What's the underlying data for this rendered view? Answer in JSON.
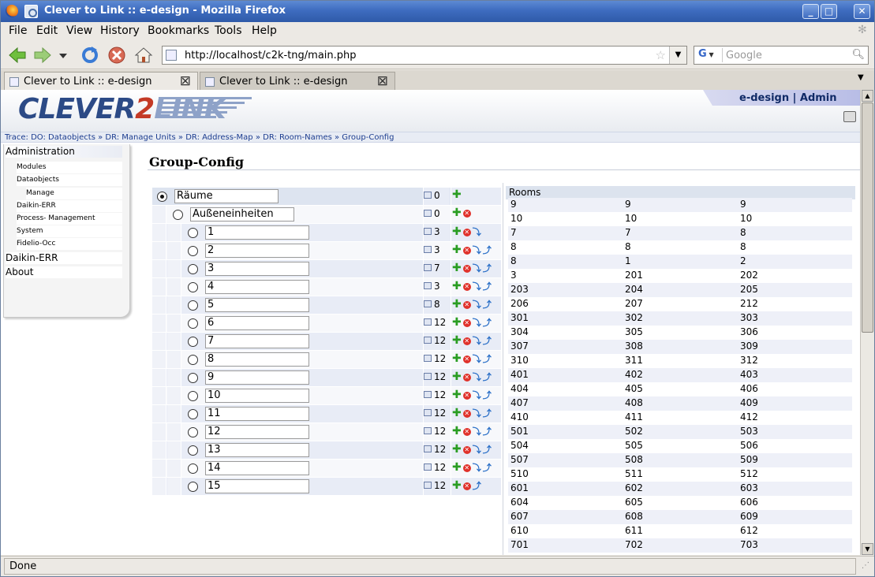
{
  "window": {
    "title": "Clever to Link :: e-design - Mozilla Firefox",
    "buttons": {
      "minimize": "_",
      "maximize": "□",
      "close": "✕"
    }
  },
  "menu": [
    "File",
    "Edit",
    "View",
    "History",
    "Bookmarks",
    "Tools",
    "Help"
  ],
  "menu_accesskeys": [
    "F",
    "E",
    "V",
    "s",
    "B",
    "T",
    "H"
  ],
  "url": "http://localhost/c2k-tng/main.php",
  "search": {
    "engine": "G",
    "placeholder": "Google"
  },
  "tabs": [
    {
      "label": "Clever to Link :: e-design",
      "active": true
    },
    {
      "label": "Clever to Link :: e-design",
      "active": false
    }
  ],
  "header": {
    "logo_part1": "CLEVER",
    "logo_part2": "2",
    "logo_part3": "LINK",
    "user": "e-design | Admin"
  },
  "trace": "Trace: DO: Dataobjects » DR: Manage Units » DR: Address-Map » DR: Room-Names » Group-Config",
  "sidebar": [
    {
      "label": "Administration",
      "level": 0
    },
    {
      "label": "Modules",
      "level": 1
    },
    {
      "label": "Dataobjects",
      "level": 1
    },
    {
      "label": "Manage",
      "level": 2
    },
    {
      "label": "Daikin-ERR",
      "level": 1
    },
    {
      "label": "Process- Management",
      "level": 1
    },
    {
      "label": "System",
      "level": 1
    },
    {
      "label": "Fidelio-Occ",
      "level": 1
    },
    {
      "label": "Daikin-ERR",
      "level": 0
    },
    {
      "label": "About",
      "level": 0
    }
  ],
  "page_title": "Group-Config",
  "tree": [
    {
      "name": "Räume",
      "count": "0",
      "level": 0,
      "selected": true,
      "actions": [
        "add"
      ]
    },
    {
      "name": "Außeneinheiten",
      "count": "0",
      "level": 1,
      "selected": false,
      "actions": [
        "add",
        "del"
      ]
    },
    {
      "name": "1",
      "count": "3",
      "level": 2,
      "selected": false,
      "actions": [
        "add",
        "del",
        "down"
      ]
    },
    {
      "name": "2",
      "count": "3",
      "level": 2,
      "selected": false,
      "actions": [
        "add",
        "del",
        "down",
        "up"
      ]
    },
    {
      "name": "3",
      "count": "7",
      "level": 2,
      "selected": false,
      "actions": [
        "add",
        "del",
        "down",
        "up"
      ]
    },
    {
      "name": "4",
      "count": "3",
      "level": 2,
      "selected": false,
      "actions": [
        "add",
        "del",
        "down",
        "up"
      ]
    },
    {
      "name": "5",
      "count": "8",
      "level": 2,
      "selected": false,
      "actions": [
        "add",
        "del",
        "down",
        "up"
      ]
    },
    {
      "name": "6",
      "count": "12",
      "level": 2,
      "selected": false,
      "actions": [
        "add",
        "del",
        "down",
        "up"
      ]
    },
    {
      "name": "7",
      "count": "12",
      "level": 2,
      "selected": false,
      "actions": [
        "add",
        "del",
        "down",
        "up"
      ]
    },
    {
      "name": "8",
      "count": "12",
      "level": 2,
      "selected": false,
      "actions": [
        "add",
        "del",
        "down",
        "up"
      ]
    },
    {
      "name": "9",
      "count": "12",
      "level": 2,
      "selected": false,
      "actions": [
        "add",
        "del",
        "down",
        "up"
      ]
    },
    {
      "name": "10",
      "count": "12",
      "level": 2,
      "selected": false,
      "actions": [
        "add",
        "del",
        "down",
        "up"
      ]
    },
    {
      "name": "11",
      "count": "12",
      "level": 2,
      "selected": false,
      "actions": [
        "add",
        "del",
        "down",
        "up"
      ]
    },
    {
      "name": "12",
      "count": "12",
      "level": 2,
      "selected": false,
      "actions": [
        "add",
        "del",
        "down",
        "up"
      ]
    },
    {
      "name": "13",
      "count": "12",
      "level": 2,
      "selected": false,
      "actions": [
        "add",
        "del",
        "down",
        "up"
      ]
    },
    {
      "name": "14",
      "count": "12",
      "level": 2,
      "selected": false,
      "actions": [
        "add",
        "del",
        "down",
        "up"
      ]
    },
    {
      "name": "15",
      "count": "12",
      "level": 2,
      "selected": false,
      "actions": [
        "add",
        "del",
        "up"
      ]
    }
  ],
  "rooms": {
    "header": "Rooms",
    "rows": [
      [
        "9",
        "9",
        "9"
      ],
      [
        "10",
        "10",
        "10"
      ],
      [
        "7",
        "7",
        "8"
      ],
      [
        "8",
        "8",
        "8"
      ],
      [
        "8",
        "1",
        "2"
      ],
      [
        "3",
        "201",
        "202"
      ],
      [
        "203",
        "204",
        "205"
      ],
      [
        "206",
        "207",
        "212"
      ],
      [
        "301",
        "302",
        "303"
      ],
      [
        "304",
        "305",
        "306"
      ],
      [
        "307",
        "308",
        "309"
      ],
      [
        "310",
        "311",
        "312"
      ],
      [
        "401",
        "402",
        "403"
      ],
      [
        "404",
        "405",
        "406"
      ],
      [
        "407",
        "408",
        "409"
      ],
      [
        "410",
        "411",
        "412"
      ],
      [
        "501",
        "502",
        "503"
      ],
      [
        "504",
        "505",
        "506"
      ],
      [
        "507",
        "508",
        "509"
      ],
      [
        "510",
        "511",
        "512"
      ],
      [
        "601",
        "602",
        "603"
      ],
      [
        "604",
        "605",
        "606"
      ],
      [
        "607",
        "608",
        "609"
      ],
      [
        "610",
        "611",
        "612"
      ],
      [
        "701",
        "702",
        "703"
      ]
    ]
  },
  "status": "Done",
  "colors": {
    "titlebar": "#3e6cc0",
    "accent": "#1b3c8f",
    "add": "#2a9d22",
    "delete": "#e0312a"
  }
}
